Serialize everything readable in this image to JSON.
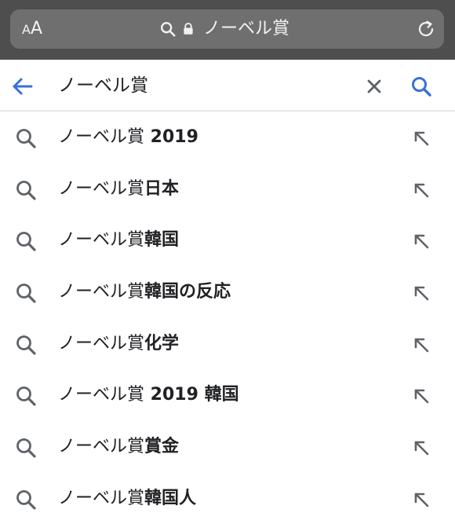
{
  "browser": {
    "text_size_button": {
      "small": "A",
      "big": "A"
    },
    "url_text": "ノーベル賞"
  },
  "search": {
    "query": "ノーベル賞"
  },
  "suggestions": [
    {
      "prefix": "ノーベル賞",
      "suffix": " 2019"
    },
    {
      "prefix": "ノーベル賞",
      "suffix": "日本"
    },
    {
      "prefix": "ノーベル賞",
      "suffix": "韓国"
    },
    {
      "prefix": "ノーベル賞",
      "suffix": "韓国の反応"
    },
    {
      "prefix": "ノーベル賞",
      "suffix": "化学"
    },
    {
      "prefix": "ノーベル賞",
      "suffix": " 2019 韓国"
    },
    {
      "prefix": "ノーベル賞",
      "suffix": "賞金"
    },
    {
      "prefix": "ノーベル賞",
      "suffix": "韓国人"
    }
  ],
  "colors": {
    "accent": "#3b6fd6",
    "icon_gray": "#5f6368",
    "topbar": "#4e4e4e",
    "urlbar": "#6f6f6f"
  }
}
